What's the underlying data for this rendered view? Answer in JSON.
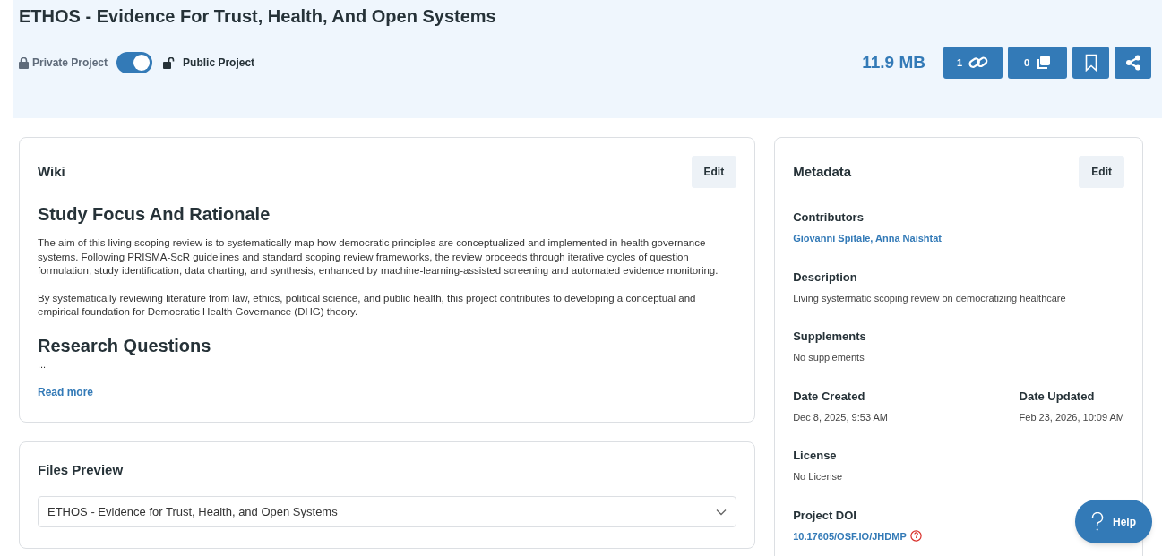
{
  "header": {
    "title": "ETHOS - Evidence For Trust, Health, And Open Systems",
    "private_label": "Private Project",
    "public_label": "Public Project",
    "public": true,
    "size": "11.9 MB",
    "buttons": [
      {
        "kind": "links",
        "count": "1"
      },
      {
        "kind": "duplicates",
        "count": "0"
      },
      {
        "kind": "bookmark"
      },
      {
        "kind": "share"
      }
    ]
  },
  "wiki": {
    "title": "Wiki",
    "edit": "Edit",
    "heading": "Study Focus And Rationale",
    "paragraphs": [
      "The aim of this living scoping review is to systematically map how democratic principles are conceptualized and implemented in health governance systems. Following PRISMA-ScR guidelines and standard scoping review frameworks, the review proceeds through iterative cycles of question formulation, study identification, data charting, and synthesis, enhanced by machine-learning-assisted screening and automated evidence monitoring.",
      "By systematically reviewing literature from law, ethics, political science, and public health, this project contributes to developing a conceptual and empirical foundation for Democratic Health Governance (DHG) theory."
    ],
    "subheading": "Research Questions",
    "ellipsis": "...",
    "read_more": "Read more"
  },
  "files_preview": {
    "title": "Files Preview",
    "selected": "ETHOS - Evidence for Trust, Health, and Open Systems"
  },
  "metadata": {
    "title": "Metadata",
    "edit": "Edit",
    "fields": [
      {
        "kind": "link",
        "label": "Contributors",
        "value": "Giovanni Spitale, Anna Naishtat"
      },
      {
        "kind": "text",
        "label": "Description",
        "value": "Living systermatic scoping review on democratizing healthcare"
      },
      {
        "kind": "text",
        "label": "Supplements",
        "value": "No supplements"
      },
      {
        "kind": "pair",
        "items": [
          {
            "label": "Date Created",
            "value": "Dec 8, 2025, 9:53 AM"
          },
          {
            "label": "Date Updated",
            "value": "Feb 23, 2026, 10:09 AM"
          }
        ]
      },
      {
        "kind": "text",
        "label": "License",
        "value": "No License"
      },
      {
        "kind": "doi",
        "label": "Project DOI",
        "value": "10.17605/OSF.IO/JHDMP"
      }
    ]
  },
  "help": {
    "label": "Help"
  }
}
